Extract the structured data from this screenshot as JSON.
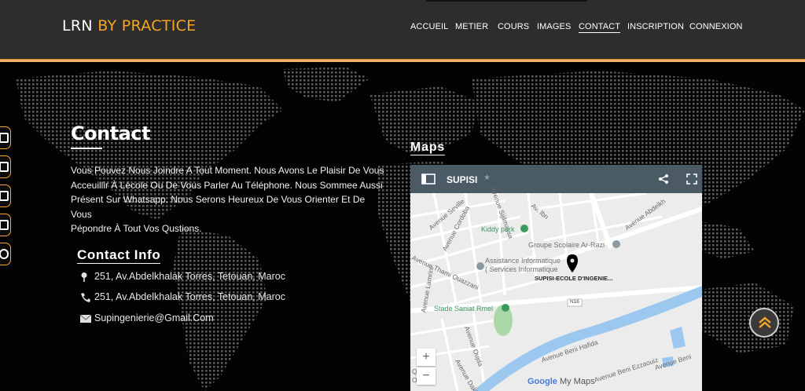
{
  "header": {
    "brand_primary": "LRN",
    "brand_accent": "BY PRACTICE",
    "nav": [
      {
        "label": "ACCUEIL",
        "active": false
      },
      {
        "label": "METIER",
        "active": false
      },
      {
        "label": "COURS",
        "active": false
      },
      {
        "label": "IMAGES",
        "active": false
      },
      {
        "label": "CONTACT",
        "active": true
      },
      {
        "label": "INSCRIPTION",
        "active": false
      },
      {
        "label": "CONNEXION",
        "active": false
      }
    ]
  },
  "social": {
    "icons": [
      "facebook-icon",
      "twitter-icon",
      "instagram-icon",
      "linkedin-icon",
      "google-icon"
    ]
  },
  "contact": {
    "title": "Contact",
    "lines": [
      "Vous Pouvez Nous Joindre A Tout Moment. Nous Avons Le Plaisir De Vous",
      "Acceuillir À Lécole Ou De Vous Parler Au Téléphone. Nous Sommee Aussi",
      "Présent Sur Whatsapp. Nous Serons Heureux De Vous Orienter Et De Vous",
      "Pépondre À Tout Vos Qustions."
    ],
    "info_title": "Contact Info",
    "address": "251, Av.Abdelkhalak Torres, Tetouan, Maroc",
    "phone": "251, Av.Abdelkhalak Torres, Tetouan, Maroc",
    "email": "Supingenierie@Gmail.Com"
  },
  "maps": {
    "title": "Maps",
    "map_name": "SUPISI",
    "star": "★",
    "labels": {
      "kiddy": "Kiddy park",
      "groupe": "Groupe Scolaire Ar-Razi",
      "assistance1": "Assistance Informatique",
      "assistance2": "( Services Informatique",
      "pin": "SUPISI-ECOLE D'INGENIE...",
      "stade": "Stade Saniat Rmel",
      "route": "N16",
      "av_seville": "Avenue Seville",
      "av_cordoba": "Avenue Cordoba",
      "av_abdelkh": "Avenue Abdelkh",
      "av_thami": "Avenue Thami Ouazzani",
      "av_lamrini": "Avenue Lamrini",
      "av_oujda": "Avenue Oujda",
      "av_beni_hafida": "Avenue Beni Hafida",
      "av_beni_ezzaouiz": "Avenue Beni Ezzaouiz",
      "av_beni": "Avenue Beni",
      "av_dakhla": "Avenue Dakhla",
      "quart1": "Quart",
      "quart2": "Oued",
      "av_sijilmassa": "Avenue Sijilmassa",
      "av_ibn": "Av. Ibn"
    },
    "zoom_in": "+",
    "zoom_out": "−",
    "google": "Google",
    "my_maps": "My Maps"
  },
  "colors": {
    "accent": "#f5a623",
    "header_bg": "#2e2c2c",
    "map_header": "#4b5b66"
  }
}
